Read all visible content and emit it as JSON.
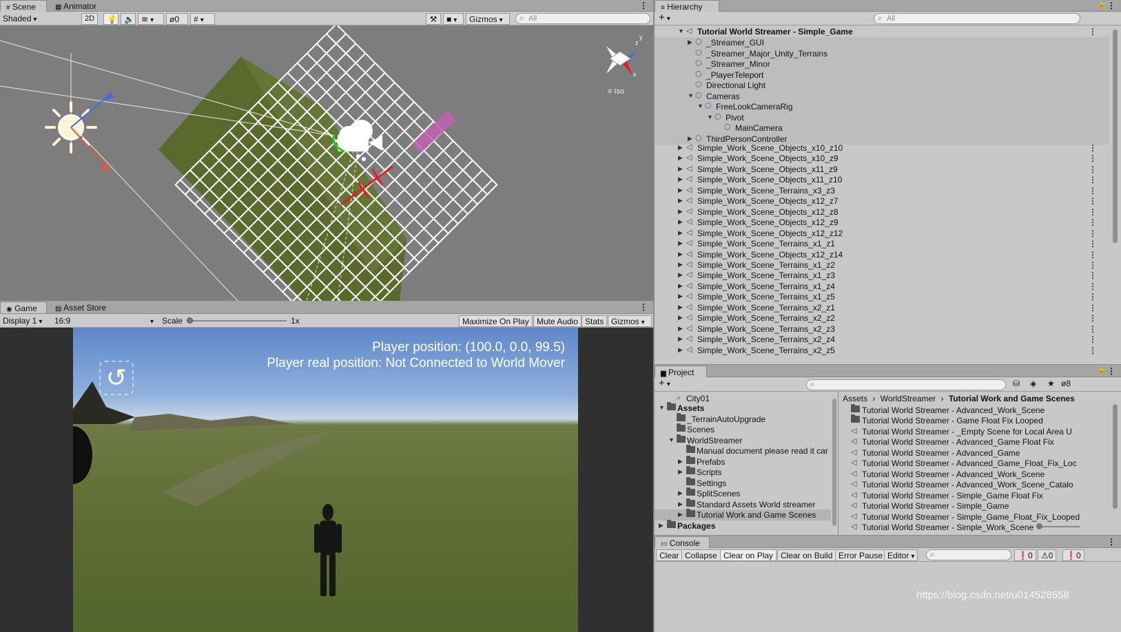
{
  "scene_panel": {
    "tabs": [
      "Scene",
      "Animator"
    ],
    "shading_mode": "Shaded",
    "mode_2d": "2D",
    "hidden_count": "0",
    "gizmos": "Gizmos",
    "search_placeholder": "All",
    "gizmo_axes": {
      "y": "y",
      "z": "z",
      "x": "x"
    },
    "projection": "Iso"
  },
  "game_panel": {
    "tabs": [
      "Game",
      "Asset Store"
    ],
    "display": "Display 1",
    "aspect": "16:9",
    "scale_label": "Scale",
    "scale_value": "1x",
    "scale_fraction": 0.0,
    "buttons": [
      "Maximize On Play",
      "Mute Audio",
      "Stats",
      "Gizmos"
    ],
    "overlay_line1": "Player position: (100.0, 0.0, 99.5)",
    "overlay_line2": "Player real position: Not Connected to World Mover"
  },
  "hierarchy": {
    "tab": "Hierarchy",
    "search_placeholder": "All",
    "root": "Tutorial World Streamer - Simple_Game",
    "children": [
      {
        "label": "_Streamer_GUI",
        "depth": 1,
        "expand": "right"
      },
      {
        "label": "_Streamer_Major_Unity_Terrains",
        "depth": 1,
        "expand": ""
      },
      {
        "label": "_Streamer_Minor",
        "depth": 1,
        "expand": ""
      },
      {
        "label": "_PlayerTeleport",
        "depth": 1,
        "expand": ""
      },
      {
        "label": "Directional Light",
        "depth": 1,
        "expand": ""
      },
      {
        "label": "Cameras",
        "depth": 1,
        "expand": "down"
      },
      {
        "label": "FreeLookCameraRig",
        "depth": 2,
        "expand": "down",
        "blue": true
      },
      {
        "label": "Pivot",
        "depth": 3,
        "expand": "down"
      },
      {
        "label": "MainCamera",
        "depth": 4,
        "expand": ""
      },
      {
        "label": "ThirdPersonController",
        "depth": 1,
        "expand": "right"
      }
    ],
    "scenes": [
      "Simple_Work_Scene_Objects_x10_z10",
      "Simple_Work_Scene_Objects_x10_z9",
      "Simple_Work_Scene_Objects_x11_z9",
      "Simple_Work_Scene_Objects_x11_z10",
      "Simple_Work_Scene_Terrains_x3_z3",
      "Simple_Work_Scene_Objects_x12_z7",
      "Simple_Work_Scene_Objects_x12_z8",
      "Simple_Work_Scene_Objects_x12_z9",
      "Simple_Work_Scene_Objects_x12_z12",
      "Simple_Work_Scene_Terrains_x1_z1",
      "Simple_Work_Scene_Objects_x12_z14",
      "Simple_Work_Scene_Terrains_x1_z2",
      "Simple_Work_Scene_Terrains_x1_z3",
      "Simple_Work_Scene_Terrains_x1_z4",
      "Simple_Work_Scene_Terrains_x1_z5",
      "Simple_Work_Scene_Terrains_x2_z1",
      "Simple_Work_Scene_Terrains_x2_z2",
      "Simple_Work_Scene_Terrains_x2_z3",
      "Simple_Work_Scene_Terrains_x2_z4",
      "Simple_Work_Scene_Terrains_x2_z5"
    ]
  },
  "project": {
    "tab": "Project",
    "hidden_count": "8",
    "favorite": "City01",
    "tree": [
      {
        "label": "Assets",
        "depth": 0,
        "expand": "down",
        "bold": true
      },
      {
        "label": "_TerrainAutoUpgrade",
        "depth": 1,
        "expand": ""
      },
      {
        "label": "Scenes",
        "depth": 1,
        "expand": ""
      },
      {
        "label": "WorldStreamer",
        "depth": 1,
        "expand": "down"
      },
      {
        "label": "Manual document please read it car",
        "depth": 2,
        "expand": ""
      },
      {
        "label": "Prefabs",
        "depth": 2,
        "expand": "right"
      },
      {
        "label": "Scripts",
        "depth": 2,
        "expand": "right"
      },
      {
        "label": "Settings",
        "depth": 2,
        "expand": ""
      },
      {
        "label": "SplitScenes",
        "depth": 2,
        "expand": "right"
      },
      {
        "label": "Standard Assets World streamer",
        "depth": 2,
        "expand": "right"
      },
      {
        "label": "Tutorial Work and Game Scenes",
        "depth": 2,
        "expand": "right",
        "selected": true
      },
      {
        "label": "Packages",
        "depth": 0,
        "expand": "right",
        "bold": true
      }
    ],
    "breadcrumb": [
      "Assets",
      "WorldStreamer",
      "Tutorial Work and Game Scenes"
    ],
    "files": [
      {
        "label": "Tutorial World Streamer - Advanced_Work_Scene",
        "kind": "folder"
      },
      {
        "label": "Tutorial World Streamer - Game Float Fix Looped",
        "kind": "folder"
      },
      {
        "label": "Tutorial World Streamer - _Empty Scene for Local Area U",
        "kind": "scene"
      },
      {
        "label": "Tutorial World Streamer - Advanced_Game Float Fix",
        "kind": "scene"
      },
      {
        "label": "Tutorial World Streamer - Advanced_Game",
        "kind": "scene"
      },
      {
        "label": "Tutorial World Streamer - Advanced_Game_Float_Fix_Loc",
        "kind": "scene"
      },
      {
        "label": "Tutorial World Streamer - Advanced_Work_Scene",
        "kind": "scene"
      },
      {
        "label": "Tutorial World Streamer - Advanced_Work_Scene_Catalo",
        "kind": "scene"
      },
      {
        "label": "Tutorial World Streamer - Simple_Game Float Fix",
        "kind": "scene"
      },
      {
        "label": "Tutorial World Streamer - Simple_Game",
        "kind": "scene"
      },
      {
        "label": "Tutorial World Streamer - Simple_Game_Float_Fix_Looped",
        "kind": "scene"
      },
      {
        "label": "Tutorial World Streamer - Simple_Work_Scene",
        "kind": "scene"
      }
    ]
  },
  "console": {
    "tab": "Console",
    "buttons": [
      "Clear",
      "Collapse",
      "Clear on Play",
      "Clear on Build",
      "Error Pause",
      "Editor"
    ],
    "info_count": "0",
    "warn_count": "0",
    "error_count": "0"
  },
  "watermark": "https://blog.csdn.net/u014528558"
}
